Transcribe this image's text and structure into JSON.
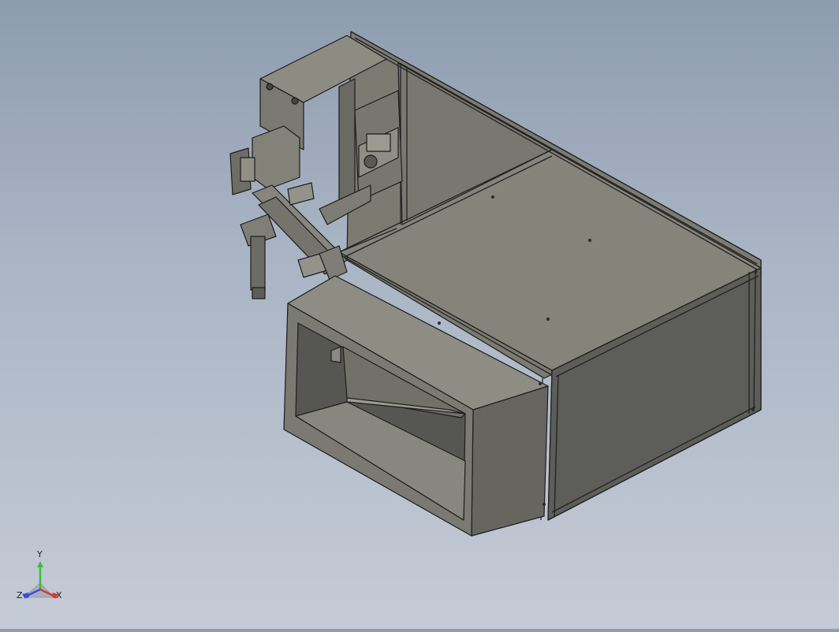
{
  "viewport": {
    "background_top": "#8e9cb0",
    "background_bottom": "#c5cbd6",
    "model_face_light": "#8a8a80",
    "model_face_mid": "#707068",
    "model_face_dark": "#5a5a56",
    "edge_color": "#1c1c1c"
  },
  "triad": {
    "x_label": "X",
    "y_label": "Y",
    "z_label": "Z",
    "x_color": "#d63b2c",
    "y_color": "#3bbd3b",
    "z_color": "#3a4fd6"
  }
}
